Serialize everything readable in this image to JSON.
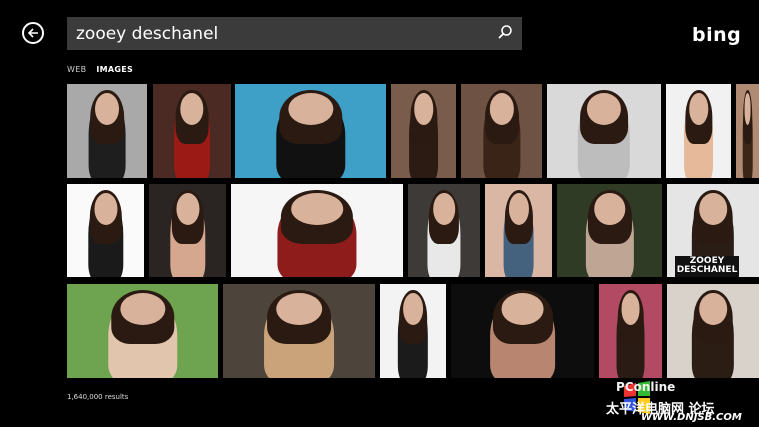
{
  "header": {
    "search_value": "zooey deschanel",
    "search_placeholder": "",
    "logo_text": "bing"
  },
  "tabs": [
    {
      "label": "WEB",
      "active": false
    },
    {
      "label": "IMAGES",
      "active": true
    }
  ],
  "results_text": "1,640,000 results",
  "grid": {
    "tile_sign": [
      "ZOOEY",
      "DESCHANEL"
    ],
    "rows": [
      [
        {
          "bg": "#a9a9a9",
          "fg": "#1e1e1e"
        },
        {
          "bg": "#4a2a22",
          "fg": "#9b1a16"
        },
        {
          "bg": "#3ea0c6",
          "fg": "#111111"
        },
        {
          "bg": "#7a5c4c",
          "fg": "#2b1b13"
        },
        {
          "bg": "#6e5243",
          "fg": "#3a2417"
        },
        {
          "bg": "#d9d9d9",
          "fg": "#bdbdbd"
        },
        {
          "bg": "#f1f1f1",
          "fg": "#e6b99a"
        },
        {
          "bg": "#b08a72",
          "fg": "#3b2618"
        }
      ],
      [
        {
          "bg": "#fafafa",
          "fg": "#1a1a1a"
        },
        {
          "bg": "#2a2522",
          "fg": "#d5a78f"
        },
        {
          "bg": "#f6f6f6",
          "fg": "#8e1c1a"
        },
        {
          "bg": "#3d3a38",
          "fg": "#e8e8e8"
        },
        {
          "bg": "#d9b7a4",
          "fg": "#44617d"
        },
        {
          "bg": "#2f3b25",
          "fg": "#bfa694"
        },
        {
          "bg": "#e5e5e5",
          "fg": "#2a1d16"
        }
      ],
      [
        {
          "bg": "#6ea34f",
          "fg": "#e1c6ad"
        },
        {
          "bg": "#4d453c",
          "fg": "#caa37a"
        },
        {
          "bg": "#f3f3f3",
          "fg": "#1b1b1b"
        },
        {
          "bg": "#0d0d0d",
          "fg": "#b88670"
        },
        {
          "bg": "#b24a63",
          "fg": "#2a1b14"
        },
        {
          "bg": "#d8d2cb",
          "fg": "#2b1c14"
        }
      ]
    ]
  },
  "watermark": {
    "line1": "PConline",
    "line2": "太平洋电脑网  论坛",
    "line3": "WWW.DNJSB.COM"
  },
  "colors": {
    "background": "#000000",
    "search_bg": "#3b3b3b"
  }
}
